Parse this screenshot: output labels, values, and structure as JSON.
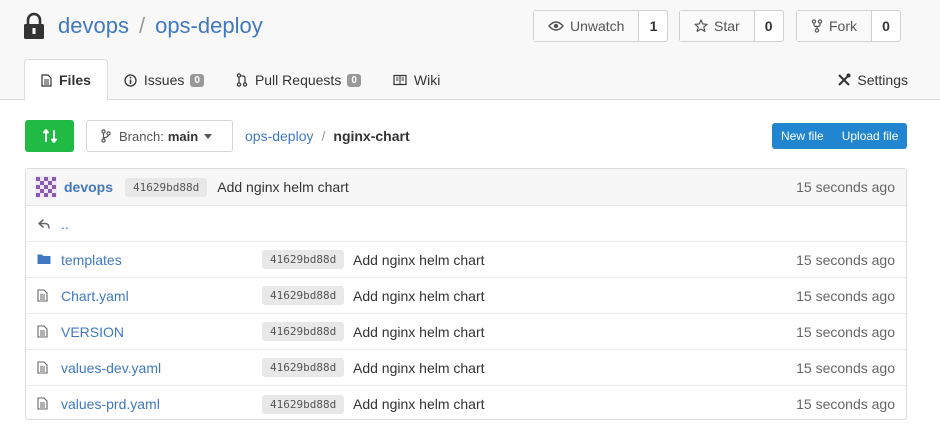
{
  "repo": {
    "owner": "devops",
    "name": "ops-deploy",
    "separator": "/"
  },
  "actions": {
    "watch": {
      "label": "Unwatch",
      "count": "1"
    },
    "star": {
      "label": "Star",
      "count": "0"
    },
    "fork": {
      "label": "Fork",
      "count": "0"
    }
  },
  "tabs": [
    {
      "label": "Files",
      "icon": "file-text-icon",
      "active": true
    },
    {
      "label": "Issues",
      "icon": "info-circle-icon",
      "badge": "0"
    },
    {
      "label": "Pull Requests",
      "icon": "git-pull-request-icon",
      "badge": "0"
    },
    {
      "label": "Wiki",
      "icon": "book-icon"
    }
  ],
  "settings": {
    "label": "Settings",
    "icon": "tools-icon"
  },
  "toolbar": {
    "branch_prefix": "Branch:",
    "branch": "main",
    "path": [
      "ops-deploy",
      "nginx-chart"
    ],
    "new_file": "New file",
    "upload_file": "Upload file"
  },
  "latest_commit": {
    "author": "devops",
    "sha": "41629bd88d",
    "message": "Add nginx helm chart",
    "age": "15 seconds ago"
  },
  "parent_dir": "..",
  "files": [
    {
      "name": "templates",
      "type": "dir",
      "sha": "41629bd88d",
      "message": "Add nginx helm chart",
      "age": "15 seconds ago"
    },
    {
      "name": "Chart.yaml",
      "type": "file",
      "sha": "41629bd88d",
      "message": "Add nginx helm chart",
      "age": "15 seconds ago"
    },
    {
      "name": "VERSION",
      "type": "file",
      "sha": "41629bd88d",
      "message": "Add nginx helm chart",
      "age": "15 seconds ago"
    },
    {
      "name": "values-dev.yaml",
      "type": "file",
      "sha": "41629bd88d",
      "message": "Add nginx helm chart",
      "age": "15 seconds ago"
    },
    {
      "name": "values-prd.yaml",
      "type": "file",
      "sha": "41629bd88d",
      "message": "Add nginx helm chart",
      "age": "15 seconds ago"
    }
  ],
  "colors": {
    "link": "#4078c0",
    "compare": "#21ba45",
    "primary": "#2185d0"
  }
}
